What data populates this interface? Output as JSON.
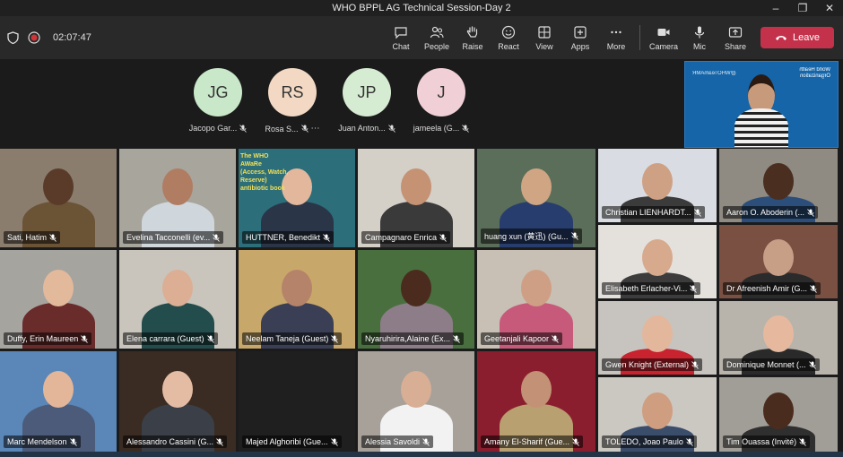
{
  "window": {
    "title": "WHO BPPL AG Technical Session-Day 2"
  },
  "toolbar": {
    "timer": "02:07:47",
    "buttons": [
      {
        "key": "chat",
        "label": "Chat"
      },
      {
        "key": "people",
        "label": "People"
      },
      {
        "key": "raise",
        "label": "Raise"
      },
      {
        "key": "react",
        "label": "React"
      },
      {
        "key": "view",
        "label": "View"
      },
      {
        "key": "apps",
        "label": "Apps"
      },
      {
        "key": "more",
        "label": "More"
      }
    ],
    "device_buttons": [
      {
        "key": "camera",
        "label": "Camera"
      },
      {
        "key": "mic",
        "label": "Mic"
      },
      {
        "key": "share",
        "label": "Share"
      }
    ],
    "leave_label": "Leave",
    "accent": "#c4314b"
  },
  "audio_only": [
    {
      "initials": "JG",
      "name": "Jacopo Gar...",
      "color": "#c9e7c9"
    },
    {
      "initials": "RS",
      "name": "Rosa S...",
      "color": "#f3d9c4"
    },
    {
      "initials": "JP",
      "name": "Juan Anton...",
      "color": "#d6ecd2"
    },
    {
      "initials": "J",
      "name": "jameela (G...",
      "color": "#f1cfd6"
    }
  ],
  "presenter_slide": {
    "text": "World Health Organization",
    "handle": "@WHOTeamAMR"
  },
  "grid": [
    {
      "name": "Sati, Hatim"
    },
    {
      "name": "Evelina Tacconelli (ev..."
    },
    {
      "name": "HUTTNER, Benedikt"
    },
    {
      "name": "Campagnaro Enrica"
    },
    {
      "name": "huang xun (黄迅) (Gu..."
    },
    {
      "name": "Christian LIENHARDT..."
    },
    {
      "name": "Aaron O. Aboderin (..."
    },
    {
      "name": "Duffy, Erin Maureen"
    },
    {
      "name": "Elena carrara (Guest)"
    },
    {
      "name": "Neelam Taneja (Guest)"
    },
    {
      "name": "Nyaruhirira,Alaine (Ex..."
    },
    {
      "name": "Geetanjali Kapoor"
    },
    {
      "name": "Elisabeth Erlacher-Vi..."
    },
    {
      "name": "Dr Afreenish Amir (G..."
    },
    {
      "name": "Marc Mendelson"
    },
    {
      "name": "Alessandro Cassini (G..."
    },
    {
      "name": "Majed Alghoribi (Gue..."
    },
    {
      "name": "Alessia Savoldi"
    },
    {
      "name": "Amany El-Sharif (Gue..."
    },
    {
      "name": "Gwen Knight (External)"
    },
    {
      "name": "Dominique Monnet (..."
    },
    {
      "name": "TOLEDO, Joao Paulo"
    },
    {
      "name": "Tim Ouassa (Invité)"
    }
  ],
  "tile_backgrounds": {
    "book_text": "The WHO AWaRe (Access, Watch, Reserve) antibiotic book"
  }
}
